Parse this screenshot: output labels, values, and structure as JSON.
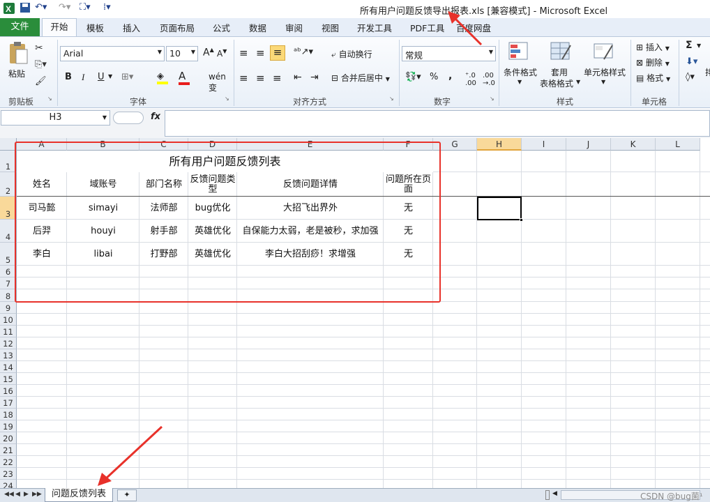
{
  "window": {
    "title": "所有用户问题反馈导出报表.xls  [兼容模式]  -  Microsoft Excel"
  },
  "tabs": [
    "文件",
    "开始",
    "模板",
    "插入",
    "页面布局",
    "公式",
    "数据",
    "审阅",
    "视图",
    "开发工具",
    "PDF工具",
    "百度网盘"
  ],
  "ribbon": {
    "clipboard": {
      "paste": "粘贴",
      "label": "剪贴板"
    },
    "font": {
      "name": "Arial",
      "size": "10",
      "label": "字体",
      "bold": "B",
      "italic": "I",
      "underline": "U"
    },
    "alignment": {
      "wrap": "自动换行",
      "merge": "合并后居中",
      "label": "对齐方式"
    },
    "number": {
      "format": "常规",
      "label": "数字",
      "percent": "%",
      "comma": ","
    },
    "styles": {
      "conditional": "条件格式",
      "table1": "套用",
      "table2": "表格格式",
      "cell_styles": "单元格样式",
      "label": "样式"
    },
    "cells": {
      "insert": "插入",
      "delete": "删除",
      "format": "格式",
      "label": "单元格"
    },
    "editing": {
      "sum": "Σ"
    }
  },
  "formula_bar": {
    "name_box": "H3",
    "fx": "fx",
    "value": ""
  },
  "columns": [
    "A",
    "B",
    "C",
    "D",
    "E",
    "F",
    "G",
    "H",
    "I",
    "J",
    "K",
    "L"
  ],
  "rows": [
    "1",
    "2",
    "3",
    "4",
    "5",
    "6",
    "7",
    "8",
    "9",
    "10",
    "11",
    "12",
    "13",
    "14",
    "15",
    "16",
    "17",
    "18",
    "19",
    "20",
    "21",
    "22",
    "23",
    "24"
  ],
  "sheet": {
    "title": "所有用户问题反馈列表",
    "headers": [
      "姓名",
      "域账号",
      "部门名称",
      "反馈问题类型",
      "反馈问题详情",
      "问题所在页面"
    ],
    "data": [
      [
        "司马懿",
        "simayi",
        "法师部",
        "bug优化",
        "大招飞出界外",
        "无"
      ],
      [
        "后羿",
        "houyi",
        "射手部",
        "英雄优化",
        "自保能力太弱，老是被秒，求加强",
        "无"
      ],
      [
        "李白",
        "libai",
        "打野部",
        "英雄优化",
        "李白大招刮痧！求增强",
        "无"
      ]
    ]
  },
  "sheet_tabs": [
    "问题反馈列表"
  ],
  "watermark": "CSDN @bug菌¹",
  "colors": {
    "file_tab": "#2a8d3b",
    "annotation": "#e8312a",
    "selection": "#000000"
  }
}
